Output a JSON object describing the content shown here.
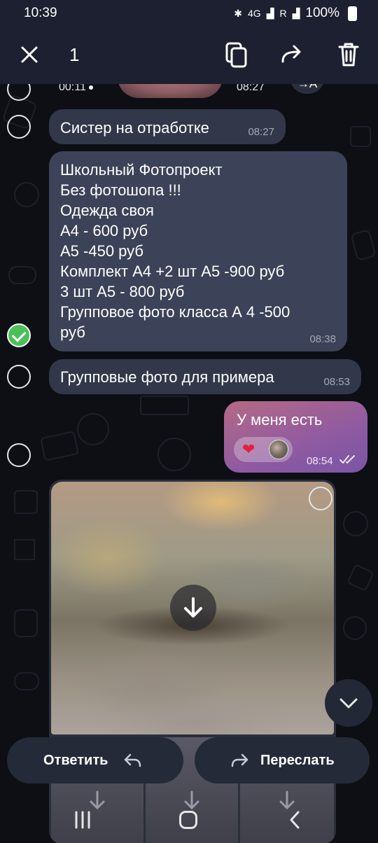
{
  "status_bar": {
    "time": "10:39",
    "network_1": "4G",
    "network_2": "R",
    "battery": "100%"
  },
  "action_bar": {
    "selected_count": "1",
    "icons": [
      "close-icon",
      "copy-icon",
      "forward-icon",
      "delete-icon"
    ]
  },
  "messages": {
    "top_video": {
      "duration": "00:11",
      "time": "08:27",
      "translate_label": "→A"
    },
    "msg1": {
      "text": "Систер на отработке",
      "time": "08:27"
    },
    "msg2": {
      "lines": [
        "Школьный Фотопроект",
        "Без фотошопа !!!",
        "Одежда своя",
        "А4 - 600 руб",
        "А5 -450 руб",
        "Комплект А4 +2 шт А5 -900 руб",
        "3 шт А5 - 800 руб",
        "Групповое фото класса  А 4 -500",
        "руб"
      ],
      "time": "08:38",
      "selected": true
    },
    "msg3": {
      "text": "Групповые фото для примера",
      "time": "08:53"
    },
    "outgoing": {
      "text": "У меня есть",
      "time": "08:54",
      "reaction": "❤",
      "read": true
    }
  },
  "bottom_actions": {
    "reply_label": "Ответить",
    "forward_label": "Переслать"
  },
  "colors": {
    "header_bg": "#1c2030",
    "bubble_in": "#323849",
    "bubble_out_gradient": [
      "#b56a84",
      "#7b55a6"
    ],
    "check_green": "#4dbf5a"
  }
}
